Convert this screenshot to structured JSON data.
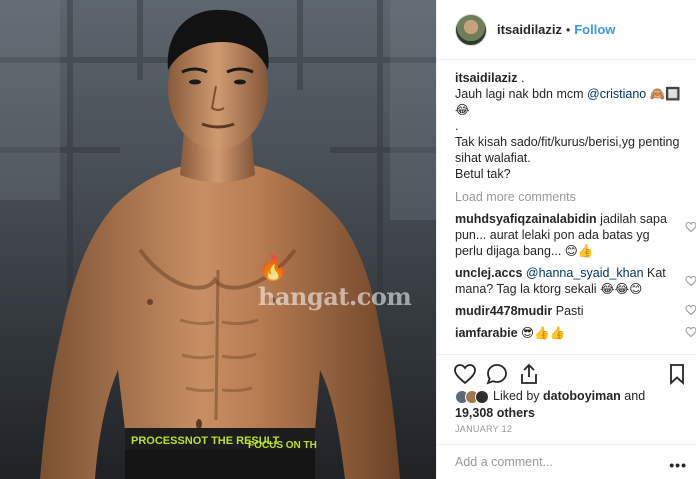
{
  "post": {
    "author": "itsaidilaziz",
    "separator": "•",
    "follow_label": "Follow"
  },
  "photo": {
    "watermark": "hangat.com",
    "waistband_left": "PROCESSNOT THE RESULT",
    "waistband_right": "FOCUS ON TH"
  },
  "caption": {
    "user": "itsaidilaziz",
    "after_user": ".",
    "line1_text": "Jauh lagi nak bdn mcm ",
    "line1_mention": "@cristiano",
    "line1_emoji": "🙈🔲😂",
    "dot_line": ".",
    "line2": "Tak kisah sado/fit/kurus/berisi,yg penting sihat walafiat.",
    "line3": "Betul tak?"
  },
  "load_more": "Load more comments",
  "comments": [
    {
      "user": "muhdsyafiqzainalabidin",
      "text": "jadilah sapa pun... aurat lelaki pon ada batas yg perlu dijaga bang... 😊👍"
    },
    {
      "user": "unclej.accs",
      "mention": "@hanna_syaid_khan",
      "text": " Kat mana? Tag la ktorg sekali 😂😂😊"
    },
    {
      "user": "mudir4478mudir",
      "text": "Pasti"
    },
    {
      "user": "iamfarabie",
      "text": "😎👍👍"
    }
  ],
  "likes": {
    "prefix": "Liked by ",
    "first_user": "datoboyiman",
    "middle": " and",
    "count": "19,308 others"
  },
  "date": "JANUARY 12",
  "add_comment": {
    "placeholder": "Add a comment..."
  },
  "more_menu": "•••",
  "colors": {
    "follow": "#3897f0",
    "mention": "#003569",
    "muted": "#999999",
    "waistband": "#b8e02a"
  },
  "icons": [
    "heart-icon",
    "comment-icon",
    "share-icon",
    "bookmark-icon",
    "small-heart-icon",
    "more-icon"
  ]
}
